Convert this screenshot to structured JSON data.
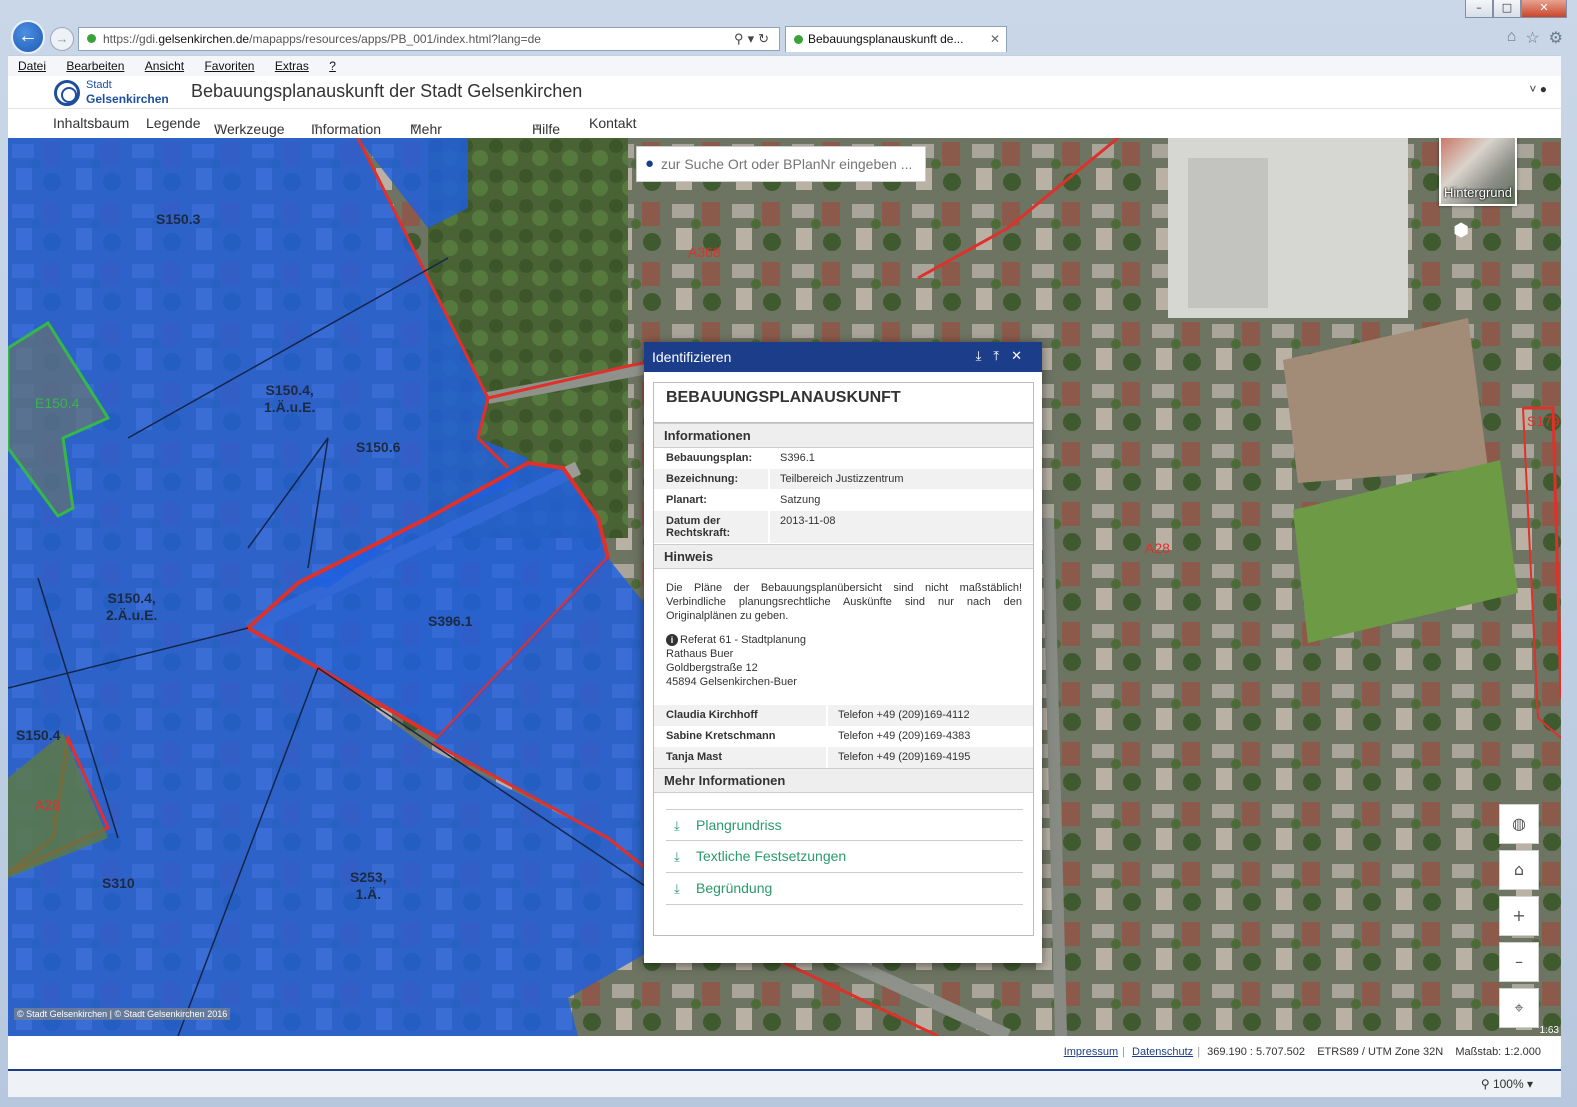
{
  "browser": {
    "url_prefix": "https://gdi.",
    "url_domain": "gelsenkirchen.de",
    "url_path": "/mapapps/resources/apps/PB_001/index.html?lang=de",
    "tab_title": "Bebauungsplanauskunft de...",
    "menu": [
      "Datei",
      "Bearbeiten",
      "Ansicht",
      "Favoriten",
      "Extras",
      "?"
    ],
    "zoom": "100%"
  },
  "app": {
    "logo_line1": "Stadt",
    "logo_line2": "Gelsenkirchen",
    "title": "Bebauungsplanauskunft der Stadt Gelsenkirchen",
    "nav": [
      "Inhaltsbaum",
      "Legende",
      "Werkzeuge",
      "Information",
      "Mehr Geodaten",
      "Hilfe",
      "Kontakt"
    ]
  },
  "map": {
    "search_placeholder": "zur Suche Ort oder BPlanNr eingeben ...",
    "basemap_label": "Hintergrund",
    "labels": {
      "s150_3": "S150.3",
      "s150_4_1": "S150.4,\n1.Ä.u.E.",
      "s150_6": "S150.6",
      "s150_4_2": "S150.4,\n2.Ä.u.E.",
      "s396_1": "S396.1",
      "s150_4_left": "S150.4",
      "s310": "S310",
      "s253": "S253,\n1.Ä.",
      "a368": "A368",
      "a28_right": "A28",
      "a28_left": "A28",
      "s179": "S179",
      "e150": "E150.4"
    },
    "attribution": "© Stadt Gelsenkirchen | © Stadt Gelsenkirchen 2016",
    "corner_scale": "1:63"
  },
  "identify": {
    "window_title": "Identifizieren",
    "heading": "BEBAUUNGSPLANAUSKUNFT",
    "sections": {
      "info": "Informationen",
      "hint": "Hinweis",
      "more": "Mehr Informationen"
    },
    "fields": [
      {
        "key": "Bebauungsplan:",
        "value": "S396.1"
      },
      {
        "key": "Bezeichnung:",
        "value": "Teilbereich Justizzentrum"
      },
      {
        "key": "Planart:",
        "value": "Satzung"
      },
      {
        "key": "Datum der Rechtskraft:",
        "value": "2013-11-08"
      }
    ],
    "hint_text": "Die Pläne der Bebauungsplanübersicht sind nicht maßstäblich! Verbindliche planungsrechtliche Auskünfte sind nur nach den Originalplänen zu geben.",
    "address": {
      "line1": "Referat 61 - Stadtplanung",
      "line2": "Rathaus Buer",
      "line3": "Goldbergstraße 12",
      "line4": "45894 Gelsenkirchen-Buer"
    },
    "contacts": [
      {
        "name": "Claudia Kirchhoff",
        "phone": "Telefon +49 (209)169-4112"
      },
      {
        "name": "Sabine Kretschmann",
        "phone": "Telefon +49 (209)169-4383"
      },
      {
        "name": "Tanja Mast",
        "phone": "Telefon +49 (209)169-4195"
      }
    ],
    "links": [
      "Plangrundriss",
      "Textliche Festsetzungen",
      "Begründung"
    ]
  },
  "footer": {
    "impressum": "Impressum",
    "datenschutz": "Datenschutz",
    "coords": "369.190 : 5.707.502",
    "crs": "ETRS89 / UTM Zone 32N",
    "scale": "Maßstab: 1:2.000"
  },
  "colors": {
    "brand": "#1c3d8a",
    "plan_fill": "#1f5fe0",
    "plan_border": "#e0302a",
    "link": "#2b9a6c"
  }
}
